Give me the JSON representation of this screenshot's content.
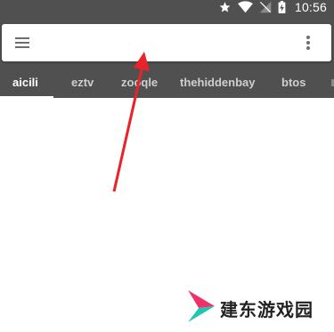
{
  "status_bar": {
    "time": "10:56",
    "icons": [
      "star-icon",
      "wifi-icon",
      "no-signal-icon",
      "battery-charging-icon"
    ]
  },
  "search_bar": {
    "placeholder": "",
    "value": "",
    "menu_icon": "menu-icon",
    "overflow_icon": "more-vertical-icon"
  },
  "tabs": [
    {
      "label": "aicili",
      "active": true
    },
    {
      "label": "eztv",
      "active": false
    },
    {
      "label": "zooqle",
      "active": false
    },
    {
      "label": "thehiddenbay",
      "active": false
    },
    {
      "label": "btos",
      "active": false
    }
  ],
  "watermark": {
    "text": "建东游戏园"
  },
  "colors": {
    "appbar": "#505050",
    "arrow": "#e8232a",
    "tab_active": "#ffffff",
    "tab_inactive": "#cfcfcf",
    "logo_pink": "#f0316a",
    "logo_teal": "#1fc7b3"
  }
}
